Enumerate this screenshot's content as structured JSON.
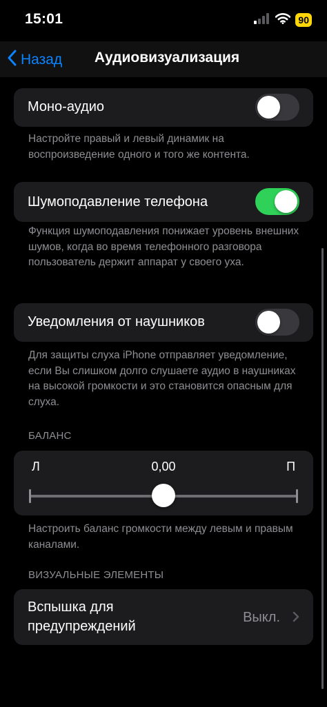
{
  "status": {
    "time": "15:01",
    "battery": "90"
  },
  "nav": {
    "back_label": "Назад",
    "title": "Аудиовизуализация"
  },
  "mono": {
    "label": "Моно-аудио",
    "on": false,
    "description": "Настройте правый и левый динамик на воспроизведение одного и того же контента."
  },
  "noise": {
    "label": "Шумоподавление телефона",
    "on": true,
    "description": "Функция шумоподавления понижает уровень внешних шумов, когда во время телефонного разговора пользователь держит аппарат у своего уха."
  },
  "headphone": {
    "label": "Уведомления от наушников",
    "on": false,
    "description": "Для защиты слуха iPhone отправляет уведомление, если Вы слишком долго слушаете аудио в наушниках на высокой громкости и это становится опасным для слуха."
  },
  "balance": {
    "header": "БАЛАНС",
    "left": "Л",
    "right": "П",
    "value_text": "0,00",
    "position": 0.5,
    "description": "Настроить баланс громкости между левым и правым каналами."
  },
  "visual": {
    "header": "ВИЗУАЛЬНЫЕ ЭЛЕМЕНТЫ",
    "flash_label": "Вспышка для предупреждений",
    "flash_value": "Выкл."
  },
  "colors": {
    "accent": "#0a84ff",
    "toggle_on": "#30d158",
    "toggle_off": "#39393d",
    "cell": "#1c1c1e",
    "secondary_text": "#8e8e93"
  },
  "icons": [
    "chevron-left-icon",
    "signal-icon",
    "wifi-icon",
    "battery-icon",
    "chevron-right-icon"
  ]
}
